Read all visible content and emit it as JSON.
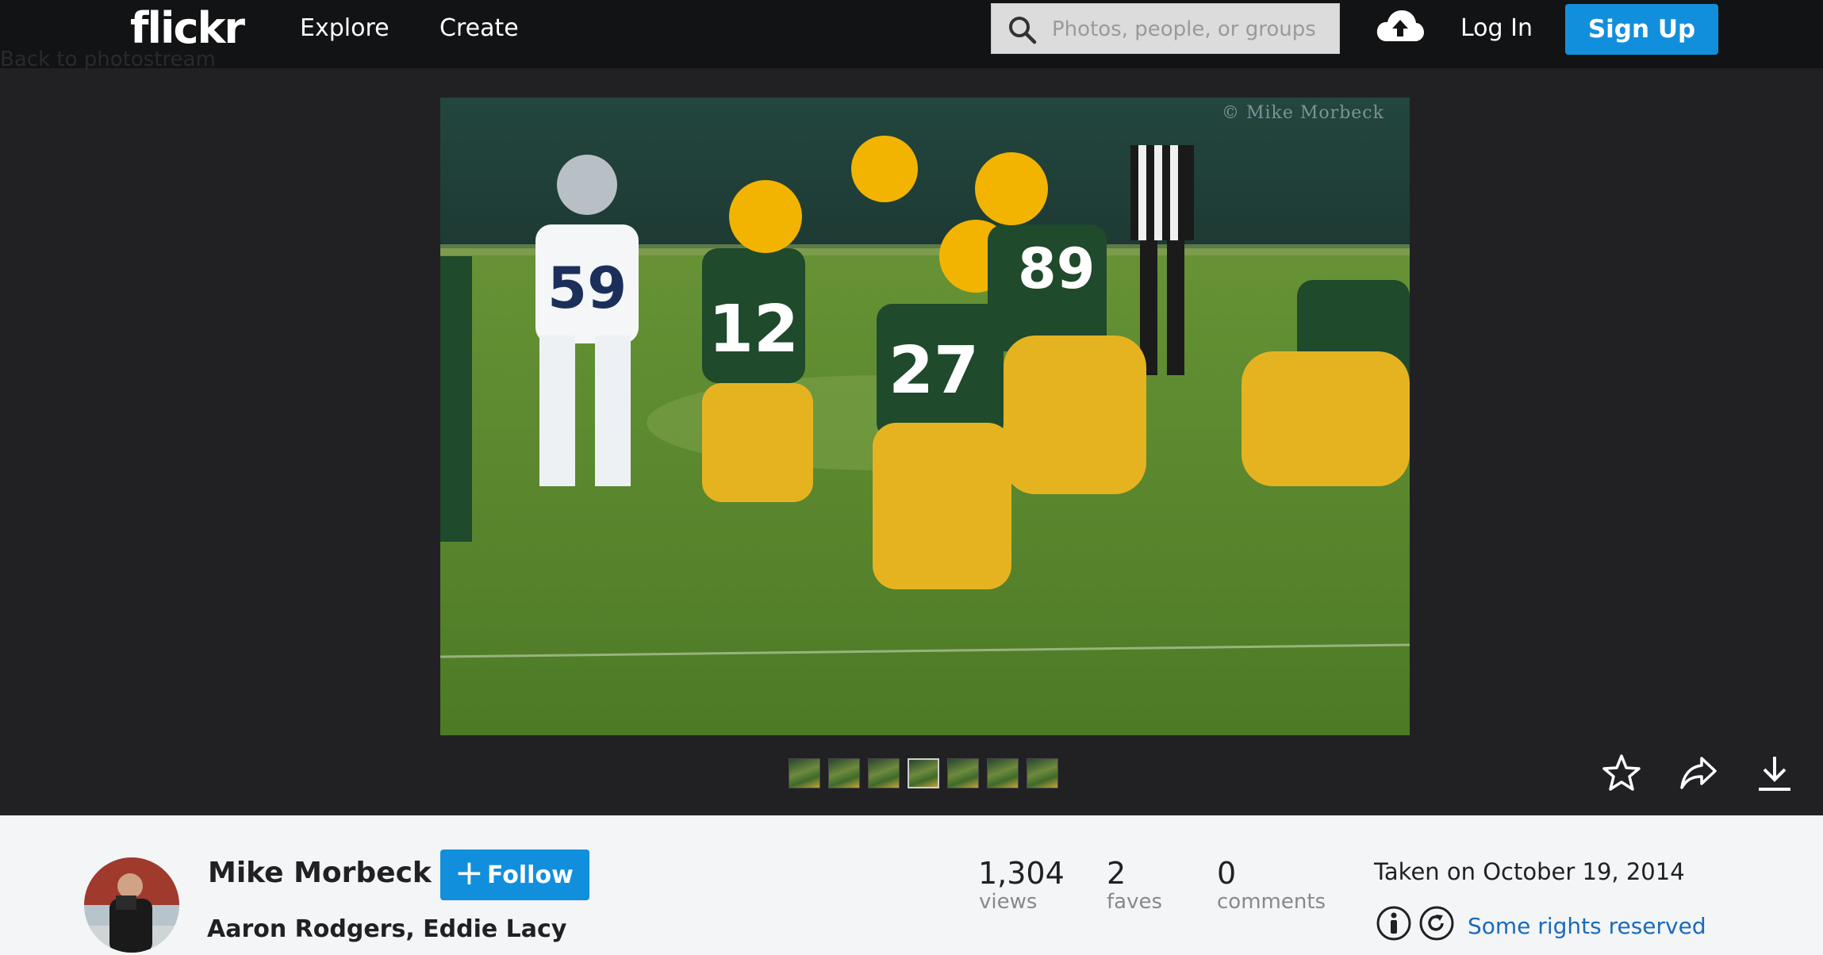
{
  "header": {
    "logo": "flickr",
    "nav": {
      "explore": "Explore",
      "create": "Create"
    },
    "search": {
      "placeholder": "Photos, people, or groups",
      "value": ""
    },
    "upload_icon": "cloud-upload-icon",
    "login": "Log In",
    "signup": "Sign Up"
  },
  "back_link": "Back to photostream",
  "photo": {
    "watermark": "© Mike Morbeck",
    "thumbnail_count": 7,
    "active_thumbnail": 4,
    "actions": [
      "star-icon",
      "share-icon",
      "download-icon"
    ]
  },
  "info": {
    "owner": "Mike Morbeck",
    "follow": {
      "icon": "plus-icon",
      "label": "Follow"
    },
    "title": "Aaron Rodgers, Eddie Lacy",
    "stats": [
      {
        "value": "1,304",
        "label": "views"
      },
      {
        "value": "2",
        "label": "faves"
      },
      {
        "value": "0",
        "label": "comments"
      }
    ],
    "taken": "Taken on October 19, 2014",
    "license": "Some rights reserved",
    "license_icons": [
      "attribution-icon",
      "share-alike-icon"
    ]
  },
  "colors": {
    "topbar": "#121314",
    "background": "#212124",
    "accent": "#128fdc",
    "info_panel": "#f3f5f6",
    "link": "#1c6bb7"
  }
}
